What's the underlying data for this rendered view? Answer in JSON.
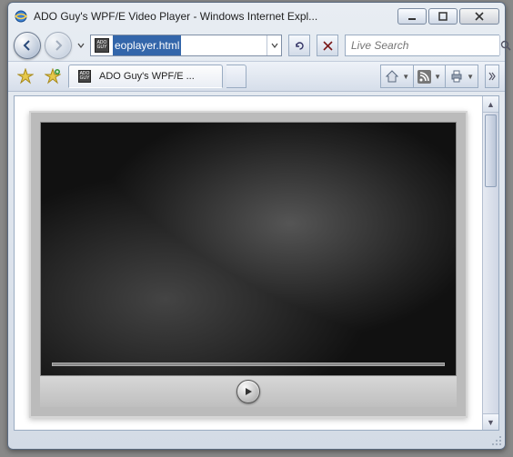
{
  "window": {
    "title": "ADO Guy's WPF/E Video Player - Windows Internet Expl..."
  },
  "nav": {
    "address_selected": "eoplayer.html",
    "search_placeholder": "Live Search"
  },
  "tab": {
    "title": "ADO Guy's WPF/E ..."
  },
  "icons": {
    "favicon_text": "ADO GUY"
  }
}
